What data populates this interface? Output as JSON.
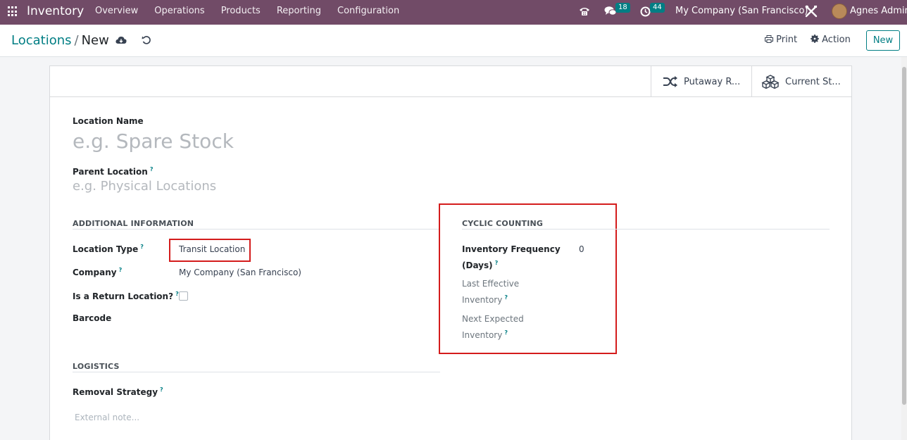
{
  "navbar": {
    "app_name": "Inventory",
    "menu": [
      "Overview",
      "Operations",
      "Products",
      "Reporting",
      "Configuration"
    ],
    "messages_count": "18",
    "activities_count": "44",
    "company": "My Company (San Francisco)",
    "user": "Agnes Admin",
    "color": "#714b67"
  },
  "control": {
    "breadcrumb_parent": "Locations",
    "breadcrumb_sep": "/",
    "breadcrumb_current": "New",
    "print_label": "Print",
    "action_label": "Action",
    "new_label": "New"
  },
  "smart_buttons": {
    "putaway": "Putaway R...",
    "current_stock": "Current St..."
  },
  "form": {
    "location_name_label": "Location Name",
    "location_name_placeholder": "e.g. Spare Stock",
    "parent_location_label": "Parent Location",
    "parent_location_placeholder": "e.g. Physical Locations",
    "additional_info_title": "ADDITIONAL INFORMATION",
    "location_type_label": "Location Type",
    "location_type_value": "Transit Location",
    "company_label": "Company",
    "company_value": "My Company (San Francisco)",
    "return_location_label": "Is a Return Location?",
    "barcode_label": "Barcode",
    "cyclic_title": "CYCLIC COUNTING",
    "inventory_frequency_label_1": "Inventory Frequency",
    "inventory_frequency_label_2": "(Days)",
    "inventory_frequency_value": "0",
    "last_effective_label_1": "Last Effective",
    "last_effective_label_2": "Inventory",
    "next_expected_label_1": "Next Expected",
    "next_expected_label_2": "Inventory",
    "logistics_title": "LOGISTICS",
    "removal_strategy_label": "Removal Strategy",
    "external_note_placeholder": "External note...",
    "help_mark": "?"
  },
  "colors": {
    "accent": "#017e84",
    "highlight": "#d41c1c"
  }
}
